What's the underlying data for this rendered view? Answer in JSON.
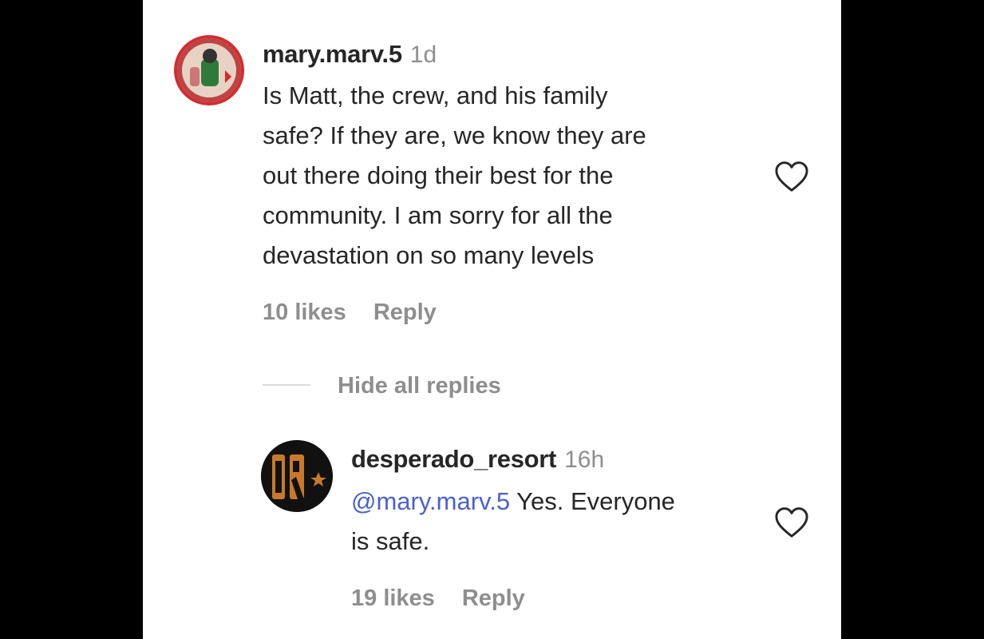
{
  "comment": {
    "username": "mary.marv.5",
    "time": "1d",
    "lines": [
      "Is Matt, the crew, and his family",
      "safe? If they are, we know they are",
      "out there doing their best for the",
      "community. I am sorry for all the",
      "devastation on so many levels"
    ],
    "likes": "10 likes",
    "reply_label": "Reply"
  },
  "replies_toggle": "Hide all replies",
  "reply": {
    "username": "desperado_resort",
    "time": "16h",
    "mention": "@mary.marv.5",
    "text_line1": " Yes. Everyone",
    "text_line2": "is safe.",
    "likes": "19 likes",
    "reply_label": "Reply",
    "avatar_text": "DR"
  },
  "icons": {
    "like": "heart-outline-icon"
  },
  "colors": {
    "mention": "#4a5fd9",
    "secondary_text": "#8e8e8e",
    "avatar_ring": "#d62b2b"
  }
}
